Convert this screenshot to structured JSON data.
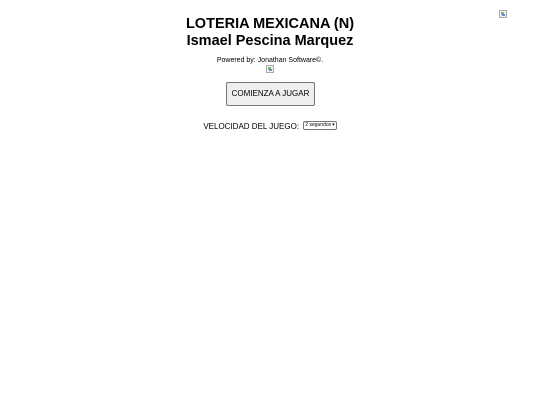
{
  "header": {
    "title": "LOTERIA MEXICANA (N)",
    "author": "Ismael Pescina Marquez",
    "powered_by": "Powered by: Jonathan Software©."
  },
  "actions": {
    "start_label": "COMIENZA A JUGAR"
  },
  "speed": {
    "label": "VELOCIDAD DEL JUEGO:",
    "selected": "2 segundos"
  },
  "icons": {
    "corner_image": "broken-image-icon",
    "logo_image": "broken-image-icon",
    "select_arrow": "chevron-down-icon"
  }
}
